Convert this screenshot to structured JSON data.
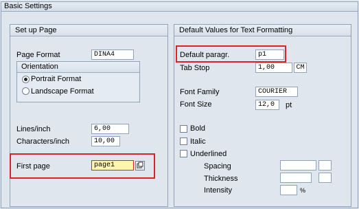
{
  "window": {
    "title": "Basic Settings"
  },
  "setup_page": {
    "title": "Set up Page",
    "page_format_label": "Page Format",
    "page_format_value": "DINA4",
    "orientation": {
      "title": "Orientation",
      "portrait_label": "Portrait Format",
      "landscape_label": "Landscape Format",
      "selected": "portrait"
    },
    "lines_per_inch_label": "Lines/inch",
    "lines_per_inch_value": "6,00",
    "chars_per_inch_label": "Characters/inch",
    "chars_per_inch_value": "10,00",
    "first_page_label": "First page",
    "first_page_value": "page1"
  },
  "text_format": {
    "title": "Default Values for Text Formatting",
    "default_paragraph_label": "Default paragr.",
    "default_paragraph_value": "p1",
    "tab_stop_label": "Tab Stop",
    "tab_stop_value": "1,00",
    "tab_stop_unit": "CM",
    "font_family_label": "Font Family",
    "font_family_value": "COURIER",
    "font_size_label": "Font Size",
    "font_size_value": "12,0",
    "font_size_unit": "pt",
    "bold_label": "Bold",
    "italic_label": "Italic",
    "underlined_label": "Underlined",
    "spacing_label": "Spacing",
    "thickness_label": "Thickness",
    "intensity_label": "Intensity",
    "intensity_unit": "%"
  },
  "colors": {
    "highlight": "#d8232a",
    "focused_field": "#fff7b0",
    "background": "#dfe6ee"
  }
}
